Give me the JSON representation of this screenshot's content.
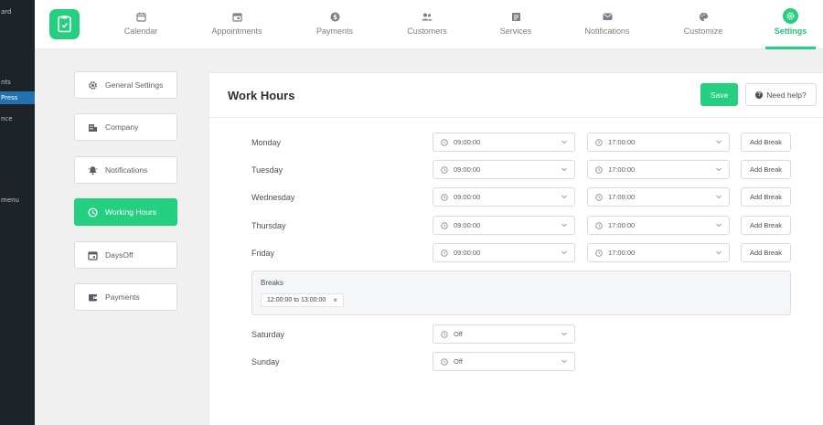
{
  "wp_sidebar": {
    "items": [
      "ard",
      "nts",
      "Press",
      "nce",
      "menu"
    ],
    "active_index": 2
  },
  "top_nav": {
    "items": [
      {
        "label": "Calendar",
        "icon": "calendar-icon"
      },
      {
        "label": "Appointments",
        "icon": "calendar-check-icon"
      },
      {
        "label": "Payments",
        "icon": "dollar-icon"
      },
      {
        "label": "Customers",
        "icon": "users-icon"
      },
      {
        "label": "Services",
        "icon": "services-icon"
      },
      {
        "label": "Notifications",
        "icon": "envelope-icon"
      },
      {
        "label": "Customize",
        "icon": "palette-icon"
      },
      {
        "label": "Settings",
        "icon": "gear-icon"
      }
    ],
    "active": "Settings"
  },
  "settings_menu": {
    "items": [
      {
        "label": "General Settings",
        "icon": "gear-icon"
      },
      {
        "label": "Company",
        "icon": "building-icon"
      },
      {
        "label": "Notifications",
        "icon": "bell-icon"
      },
      {
        "label": "Working Hours",
        "icon": "clock-icon"
      },
      {
        "label": "DaysOff",
        "icon": "calendar-icon"
      },
      {
        "label": "Payments",
        "icon": "wallet-icon"
      }
    ],
    "active": "Working Hours"
  },
  "panel": {
    "title": "Work Hours",
    "save_label": "Save",
    "help_label": "Need help?"
  },
  "days": [
    {
      "name": "Monday",
      "start": "09:00:00",
      "end": "17:00:00",
      "add_break": "Add Break"
    },
    {
      "name": "Tuesday",
      "start": "09:00:00",
      "end": "17:00:00",
      "add_break": "Add Break"
    },
    {
      "name": "Wednesday",
      "start": "09:00:00",
      "end": "17:00:00",
      "add_break": "Add Break"
    },
    {
      "name": "Thursday",
      "start": "09:00:00",
      "end": "17:00:00",
      "add_break": "Add Break"
    },
    {
      "name": "Friday",
      "start": "09:00:00",
      "end": "17:00:00",
      "add_break": "Add Break"
    }
  ],
  "breaks": {
    "title": "Breaks",
    "items": [
      {
        "label": "12:00:00 to 13:00:00",
        "remove": "×"
      }
    ]
  },
  "weekend": [
    {
      "name": "Saturday",
      "value": "Off"
    },
    {
      "name": "Sunday",
      "value": "Off"
    }
  ],
  "colors": {
    "accent": "#24d07f",
    "wp_sidebar": "#1d2327",
    "wp_active": "#2271b1"
  }
}
